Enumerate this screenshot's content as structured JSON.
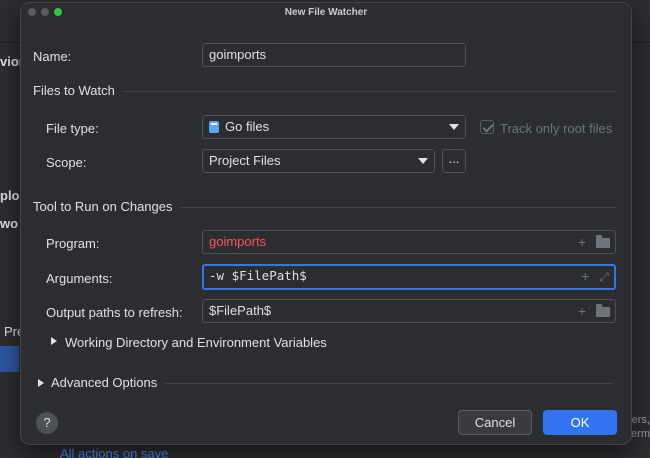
{
  "background": {
    "side_labels": [
      "vior",
      "plo",
      "wo",
      "Pre"
    ],
    "link": "All actions on save",
    "right_fragments": [
      "ers,",
      "term"
    ]
  },
  "dialog": {
    "title": "New File Watcher",
    "name_label": "Name:",
    "name_value": "goimports",
    "files_to_watch": {
      "section_title": "Files to Watch",
      "file_type_label": "File type:",
      "file_type_value": "Go files",
      "file_type_icon": "go-file-icon",
      "track_root_label": "Track only root files",
      "track_root_checked": true,
      "scope_label": "Scope:",
      "scope_value": "Project Files",
      "scope_button": "..."
    },
    "tool": {
      "section_title": "Tool to Run on Changes",
      "program_label": "Program:",
      "program_value": "goimports",
      "arguments_label": "Arguments:",
      "arguments_value": "-w $FilePath$",
      "output_label": "Output paths to refresh:",
      "output_value": "$FilePath$",
      "working_dir_label": "Working Directory and Environment Variables"
    },
    "advanced_label": "Advanced Options",
    "help_label": "?",
    "cancel_label": "Cancel",
    "ok_label": "OK"
  },
  "colors": {
    "accent": "#3574f0",
    "error_text": "#f75464",
    "dialog_bg": "#2b2d30"
  }
}
